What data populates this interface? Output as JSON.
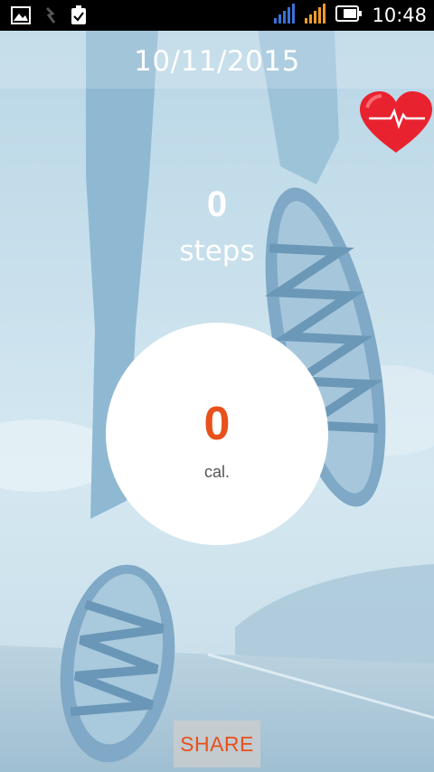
{
  "status_bar": {
    "time": "10:48",
    "icons": [
      "gallery-icon",
      "usb-icon",
      "clipboard-check-icon",
      "signal-icon-1",
      "signal-icon-2",
      "battery-icon"
    ],
    "signal1_color": "#3a72d8",
    "signal2_color": "#f39a2b"
  },
  "header": {
    "date": "10/11/2015"
  },
  "activity": {
    "steps_count": "0",
    "steps_label": "steps",
    "calories_value": "0",
    "calories_unit": "cal."
  },
  "actions": {
    "share_label": "SHARE"
  },
  "colors": {
    "accent": "#e8501c",
    "heart": "#e8232f"
  }
}
